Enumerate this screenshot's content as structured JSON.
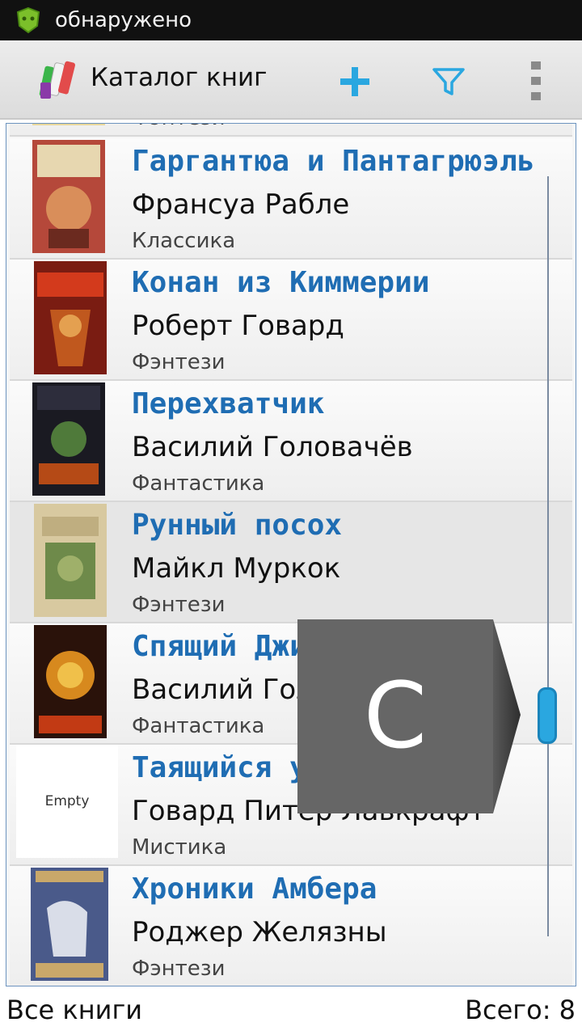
{
  "status_bar": {
    "notification_text": "обнаружено",
    "icon": "android-shield-icon"
  },
  "action_bar": {
    "title": "Каталог книг",
    "logo_icon": "books-icon",
    "actions": [
      {
        "icon": "add-icon",
        "color": "#2aa7e0"
      },
      {
        "icon": "filter-icon",
        "color": "#2aa7e0"
      },
      {
        "icon": "overflow-menu-icon",
        "color": "#888888"
      }
    ]
  },
  "partial_top_row": {
    "genre": "Фэнтези"
  },
  "books": [
    {
      "title": "Гаргантюа и Пантагрюэль",
      "author": "Франсуа Рабле",
      "genre": "Классика",
      "cover": "image"
    },
    {
      "title": "Конан из Киммерии",
      "author": "Роберт Говард",
      "genre": "Фэнтези",
      "cover": "image"
    },
    {
      "title": "Перехватчик",
      "author": "Василий Головачёв",
      "genre": "Фантастика",
      "cover": "image"
    },
    {
      "title": "Рунный посох",
      "author": "Майкл Муркок",
      "genre": "Фэнтези",
      "cover": "image",
      "selected": true
    },
    {
      "title": "Спящий Джинн",
      "author": "Василий Головачёв",
      "genre": "Фантастика",
      "cover": "image"
    },
    {
      "title": "Таящийся у порога",
      "author": "Говард Питер Лавкрафт",
      "genre": "Мистика",
      "cover": "empty",
      "cover_text": "Empty"
    },
    {
      "title": "Хроники Амбера",
      "author": "Роджер Желязны",
      "genre": "Фэнтези",
      "cover": "image"
    }
  ],
  "fast_scroll": {
    "letter": "С",
    "popup_color": "#666666",
    "thumb_color": "#2aa7e0"
  },
  "footer": {
    "filter_label": "Все книги",
    "total_label": "Всего: 8"
  }
}
